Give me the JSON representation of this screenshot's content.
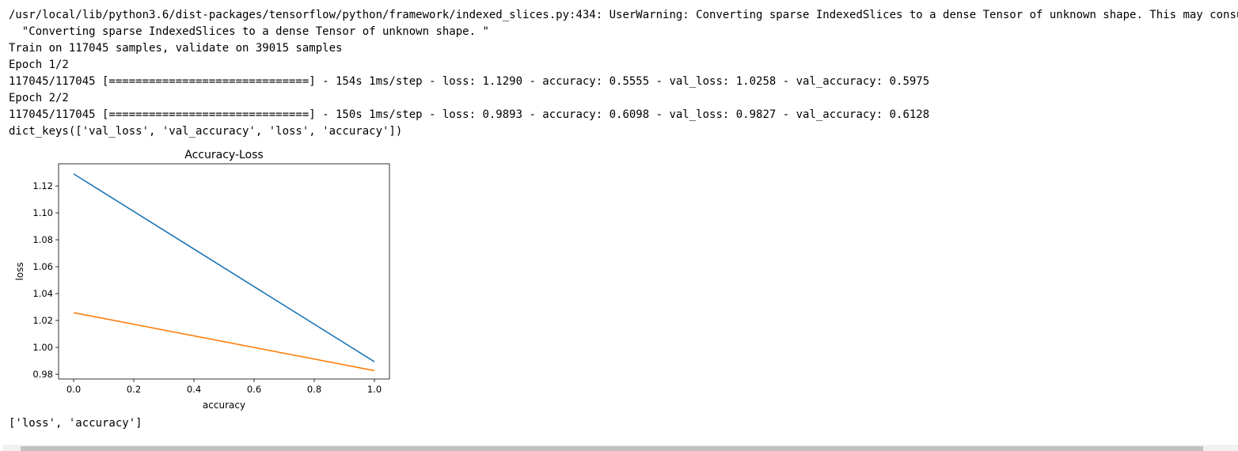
{
  "output": {
    "lines": [
      "/usr/local/lib/python3.6/dist-packages/tensorflow/python/framework/indexed_slices.py:434: UserWarning: Converting sparse IndexedSlices to a dense Tensor of unknown shape. This may consume a large amount of memory.",
      "  \"Converting sparse IndexedSlices to a dense Tensor of unknown shape. \"",
      "Train on 117045 samples, validate on 39015 samples",
      "Epoch 1/2",
      "117045/117045 [==============================] - 154s 1ms/step - loss: 1.1290 - accuracy: 0.5555 - val_loss: 1.0258 - val_accuracy: 0.5975",
      "Epoch 2/2",
      "117045/117045 [==============================] - 150s 1ms/step - loss: 0.9893 - accuracy: 0.6098 - val_loss: 0.9827 - val_accuracy: 0.6128",
      "dict_keys(['val_loss', 'val_accuracy', 'loss', 'accuracy'])"
    ],
    "result": "['loss', 'accuracy']"
  },
  "chart_data": {
    "type": "line",
    "title": "Accuracy-Loss",
    "xlabel": "accuracy",
    "ylabel": "loss",
    "xlim": [
      -0.05,
      1.05
    ],
    "ylim": [
      0.9765,
      1.1365
    ],
    "xticks": [
      0.0,
      0.2,
      0.4,
      0.6,
      0.8,
      1.0
    ],
    "xtick_labels": [
      "0.0",
      "0.2",
      "0.4",
      "0.6",
      "0.8",
      "1.0"
    ],
    "yticks": [
      0.98,
      1.0,
      1.02,
      1.04,
      1.06,
      1.08,
      1.1,
      1.12
    ],
    "ytick_labels": [
      "0.98",
      "1.00",
      "1.02",
      "1.04",
      "1.06",
      "1.08",
      "1.10",
      "1.12"
    ],
    "grid": false,
    "series": [
      {
        "x": [
          0,
          1
        ],
        "values": [
          1.129,
          0.9893
        ],
        "color": "#1f77b4"
      },
      {
        "x": [
          0,
          1
        ],
        "values": [
          1.0258,
          0.9827
        ],
        "color": "#ff7f0e"
      }
    ]
  }
}
